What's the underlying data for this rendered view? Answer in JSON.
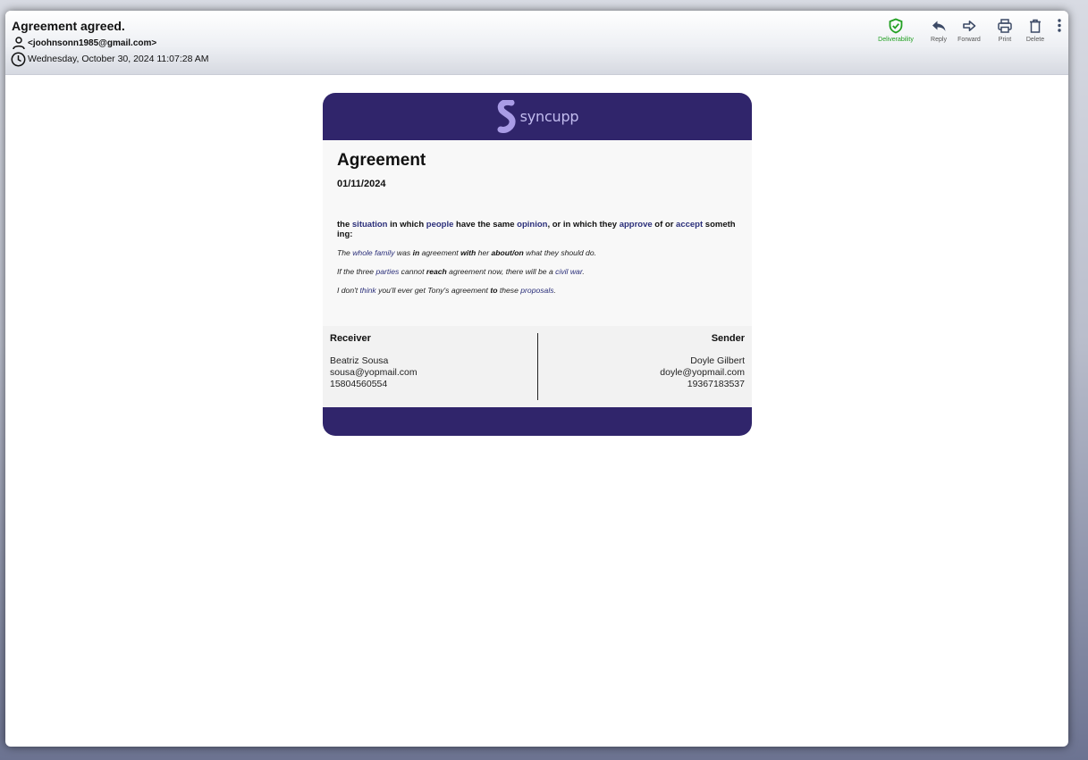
{
  "email": {
    "subject": "Agreement agreed.",
    "sender": "<joohnsonn1985@gmail.com>",
    "datetime": "Wednesday, October 30, 2024 11:07:28 AM"
  },
  "toolbar": {
    "deliverability": "Deliverability",
    "reply": "Reply",
    "forward": "Forward",
    "print": "Print",
    "delete": "Delete"
  },
  "content": {
    "logo_text": "syncupp",
    "title": "Agreement",
    "date": "01/11/2024",
    "definition": {
      "p1": "the ",
      "w1": "situation",
      "p2": " in which ",
      "w2": "people",
      "p3": " have the same ",
      "w3": "opinion",
      "p4": ", or in which they ",
      "w4": "approve",
      "p5": " of or ",
      "w5": "accept",
      "p6": " someth ing:"
    },
    "example1": {
      "a": "The ",
      "l1": "whole",
      "b": " ",
      "l2": "family",
      "c": " was ",
      "k1": "in",
      "d": " agreement ",
      "k2": "with",
      "e": " her ",
      "k3": "about/on",
      "f": " what they should do."
    },
    "example2": {
      "a": "If the three ",
      "l1": "parties",
      "b": " cannot ",
      "k1": "reach",
      "c": " agreement now, there will be a ",
      "l2": "civil war",
      "d": "."
    },
    "example3": {
      "a": "I don't ",
      "l1": "think",
      "b": " you'll ever get Tony's agreement ",
      "k1": "to",
      "c": " these ",
      "l2": "proposals",
      "d": "."
    },
    "receiver": {
      "heading": "Receiver",
      "name": "Beatriz Sousa",
      "email": "sousa@yopmail.com",
      "phone": "15804560554"
    },
    "sender": {
      "heading": "Sender",
      "name": "Doyle Gilbert",
      "email": "doyle@yopmail.com",
      "phone": "19367183537"
    }
  },
  "colors": {
    "brand": "#30256b",
    "deliverability": "#22a022"
  }
}
